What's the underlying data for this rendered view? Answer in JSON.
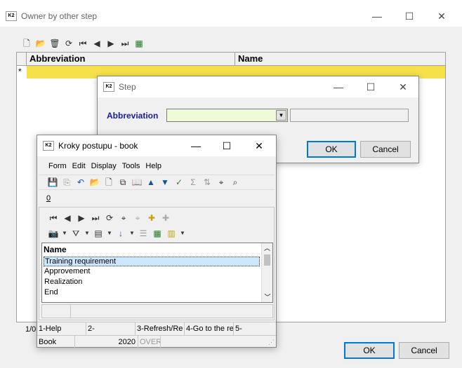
{
  "main_window": {
    "title": "Owner by other step",
    "grid_headers": [
      "Abbreviation",
      "Name"
    ],
    "new_row_marker": "*",
    "record_counter": "1/0",
    "ok_label": "OK",
    "cancel_label": "Cancel"
  },
  "step_dialog": {
    "title": "Step",
    "abbreviation_label": "Abbreviation",
    "abbreviation_value": "",
    "name_value": "",
    "ok_label": "OK",
    "cancel_label": "Cancel"
  },
  "kroky_window": {
    "title": "Kroky postupu - book",
    "menu": [
      "Form",
      "Edit",
      "Display",
      "Tools",
      "Help"
    ],
    "tab_label": "0",
    "list_header": "Name",
    "list_items": [
      "Training requirement",
      "Approvement",
      "Realization",
      "End"
    ],
    "status_row1": [
      "1-Help",
      "2-",
      "3-Refresh/Re",
      "4-Go to the re",
      "5-"
    ],
    "status_row2": [
      "Book",
      "",
      "2020",
      "OVER"
    ]
  },
  "colors": {
    "highlight_row": "#f5e04a",
    "input_bg": "#eefad8",
    "selected_item": "#cce8ff",
    "label_blue": "#1a1aa0"
  }
}
